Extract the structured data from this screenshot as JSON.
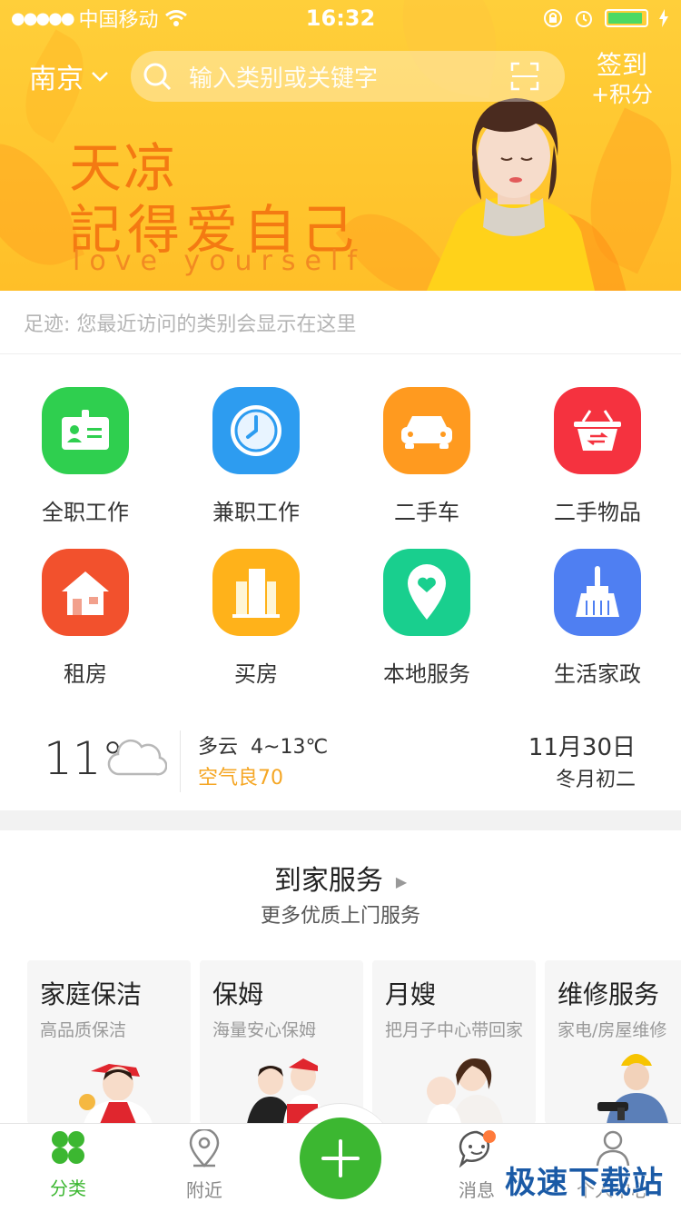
{
  "status_bar": {
    "carrier": "中国移动",
    "time": "16:32"
  },
  "header": {
    "city": "南京",
    "search_placeholder": "输入类别或关键字",
    "signin_line1": "签到",
    "signin_line2": "+积分"
  },
  "banner": {
    "line1": "天凉",
    "line2": "記得爱自己",
    "line3": "love yourself"
  },
  "footprint": {
    "text": "足迹: 您最近访问的类别会显示在这里"
  },
  "categories": [
    {
      "label": "全职工作",
      "icon": "id-card-icon",
      "color": "#2fcf4f"
    },
    {
      "label": "兼职工作",
      "icon": "clock-icon",
      "color": "#2d9cf0"
    },
    {
      "label": "二手车",
      "icon": "car-icon",
      "color": "#ff9a1f"
    },
    {
      "label": "二手物品",
      "icon": "basket-icon",
      "color": "#f5323f"
    },
    {
      "label": "租房",
      "icon": "house-icon",
      "color": "#f2512d"
    },
    {
      "label": "买房",
      "icon": "building-icon",
      "color": "#ffb21a"
    },
    {
      "label": "本地服务",
      "icon": "location-heart-icon",
      "color": "#19cf8e"
    },
    {
      "label": "生活家政",
      "icon": "broom-icon",
      "color": "#4f7ff2"
    }
  ],
  "weather": {
    "temperature": "11°",
    "condition": "多云",
    "range": "4~13℃",
    "air": "空气良70",
    "date": "11月30日",
    "lunar": "冬月初二"
  },
  "services": {
    "title": "到家服务",
    "subtitle": "更多优质上门服务",
    "cards": [
      {
        "title": "家庭保洁",
        "sub": "高品质保洁"
      },
      {
        "title": "保姆",
        "sub": "海量安心保姆"
      },
      {
        "title": "月嫂",
        "sub": "把月子中心带回家"
      },
      {
        "title": "维修服务",
        "sub": "家电/房屋维修"
      }
    ]
  },
  "tabbar": {
    "tab1": "分类",
    "tab2": "附近",
    "tab4": "消息",
    "tab5": "个人中心"
  },
  "watermark": "极速下载站",
  "colors": {
    "accent": "#3cb731",
    "banner": "#ffc62e",
    "slogan": "#f47a12",
    "air": "#f5a623"
  }
}
